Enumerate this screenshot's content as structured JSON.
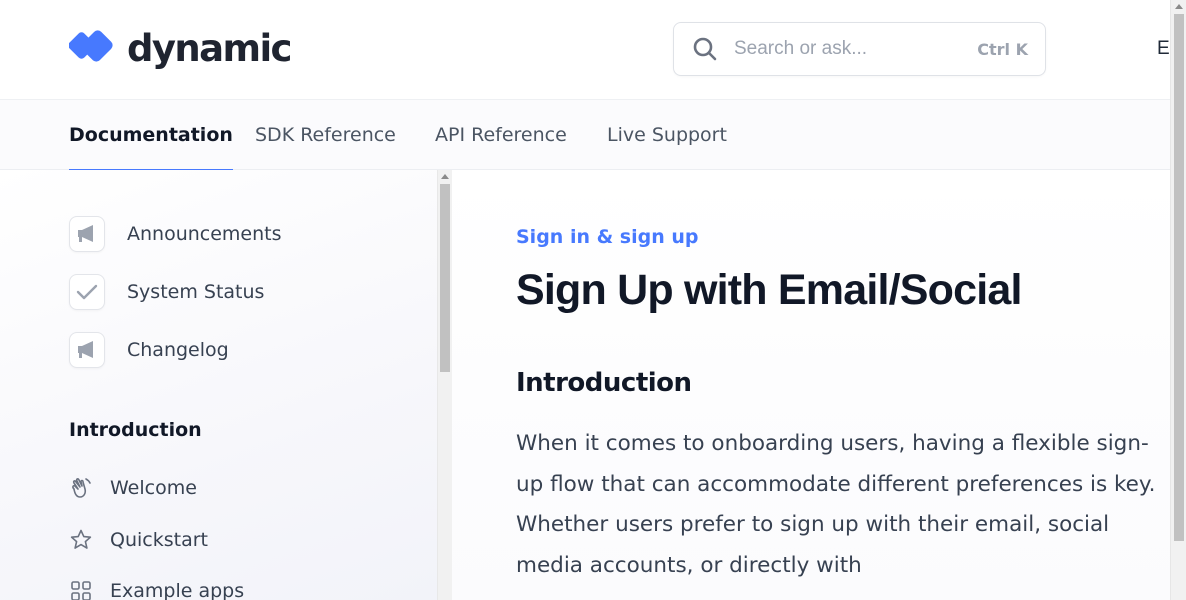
{
  "header": {
    "logo_text": "dynamic",
    "logo_icon": "dynamic-logo-mark",
    "brand_color": "#4779fe",
    "search": {
      "placeholder": "Search or ask...",
      "shortcut": "Ctrl K",
      "icon": "search-icon"
    },
    "cut_off_text": "E"
  },
  "tabs": [
    {
      "label": "Documentation",
      "active": true
    },
    {
      "label": "SDK Reference",
      "active": false
    },
    {
      "label": "API Reference",
      "active": false
    },
    {
      "label": "Live Support",
      "active": false
    }
  ],
  "sidebar": {
    "pinned": [
      {
        "label": "Announcements",
        "icon": "megaphone-icon"
      },
      {
        "label": "System Status",
        "icon": "check-icon"
      },
      {
        "label": "Changelog",
        "icon": "megaphone-icon"
      }
    ],
    "section_title": "Introduction",
    "items": [
      {
        "label": "Welcome",
        "icon": "waving-hand-icon"
      },
      {
        "label": "Quickstart",
        "icon": "star-icon"
      },
      {
        "label": "Example apps",
        "icon": "grid-icon"
      }
    ]
  },
  "main": {
    "eyebrow": "Sign in & sign up",
    "title": "Sign Up with Email/Social",
    "heading": "Introduction",
    "paragraph": "When it comes to onboarding users, having a flexible sign-up flow that can accommodate different preferences is key. Whether users prefer to sign up with their email, social media accounts, or directly with"
  }
}
